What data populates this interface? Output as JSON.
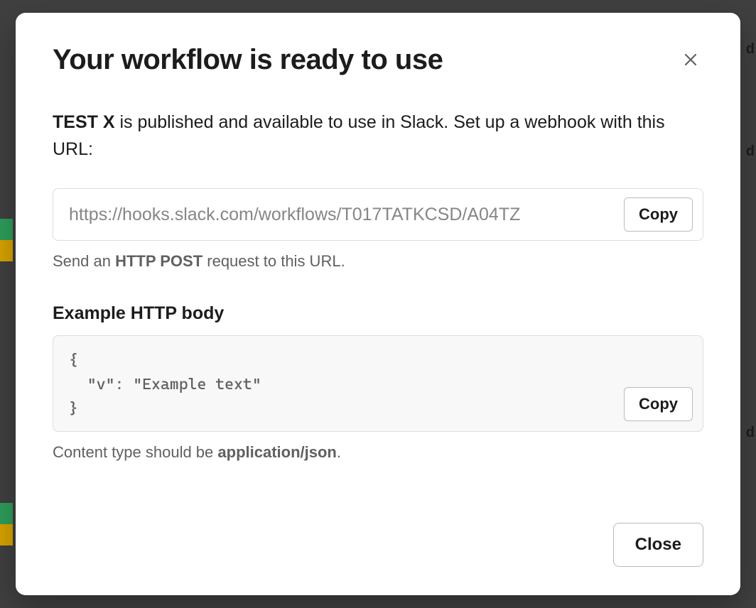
{
  "modal": {
    "title": "Your workflow is ready to use",
    "description": {
      "workflow_name": "TEST X",
      "rest": " is published and available to use in Slack. Set up a webhook with this URL:"
    },
    "url_box": {
      "url": "https://hooks.slack.com/workflows/T017TATKCSD/A04TZ",
      "copy_label": "Copy"
    },
    "url_helper": {
      "prefix": "Send an ",
      "bold": "HTTP POST",
      "suffix": " request to this URL."
    },
    "example_section": {
      "heading": "Example HTTP body",
      "code": "{\n  \"v\": \"Example text\"\n}",
      "copy_label": "Copy"
    },
    "content_type": {
      "prefix": "Content type should be ",
      "bold": "application/json",
      "suffix": "."
    },
    "close_label": "Close"
  },
  "background": {
    "letter": "d"
  }
}
